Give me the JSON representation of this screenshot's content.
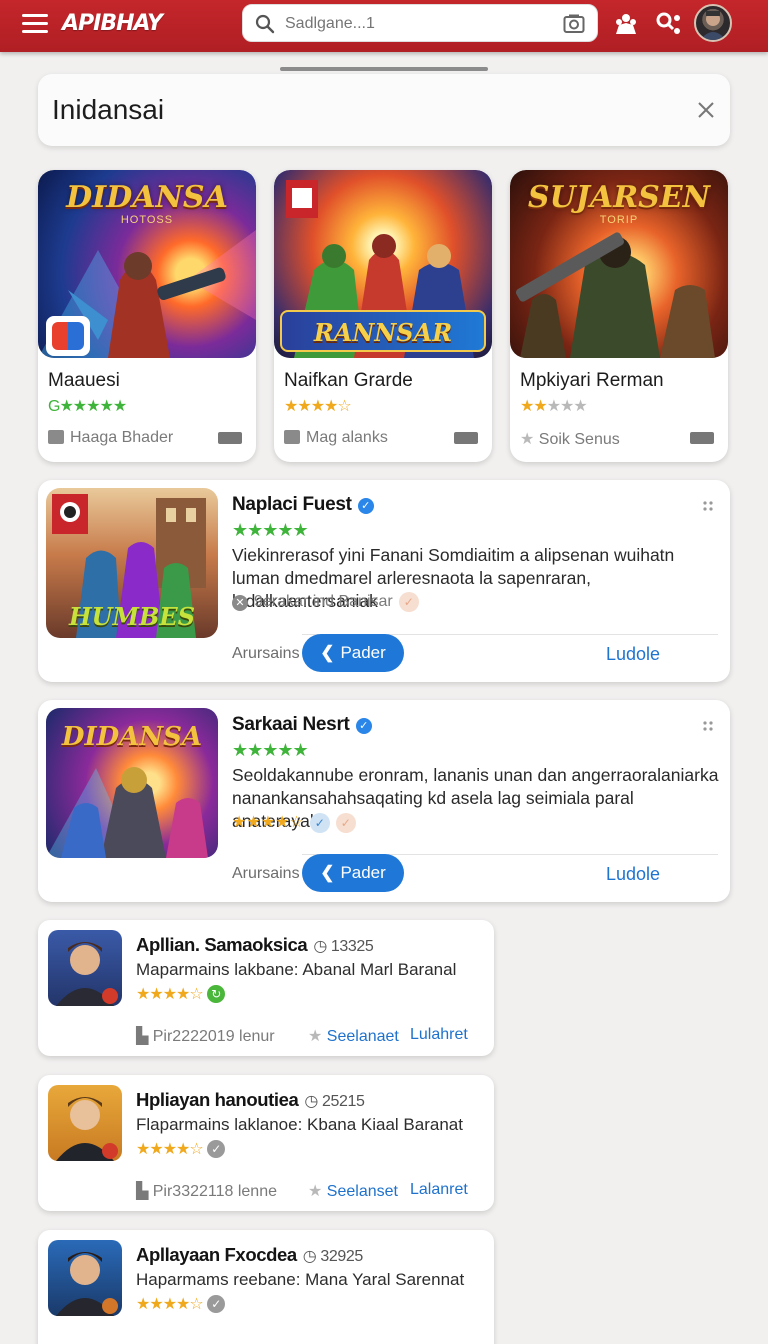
{
  "header": {
    "logo": "APIBHAY",
    "search_placeholder": "Sadlgane...1"
  },
  "panel": {
    "title": "Inidansai"
  },
  "featured": [
    {
      "art_title": "DIDANSA",
      "art_sub": "HOTOSS",
      "name": "Maauesi",
      "rating_text": "G★★★★★",
      "foot": "Haaga Bhader"
    },
    {
      "art_title": "RANNSAR",
      "art_sub": "",
      "name": "Naifkan Grarde",
      "rating_text": "★★★★☆",
      "foot": "Mag alanks"
    },
    {
      "art_title": "SUJARSEN",
      "art_sub": "TORIP",
      "name": "Mpkiyari Rerman",
      "rating_text": "★★★★★",
      "foot": "Soik Senus"
    }
  ],
  "wide": [
    {
      "name": "Naplaci Fuest",
      "stars": "★★★★★",
      "desc": "Viekinrerasof yini Fanani Somdiaitim a alipsenan wuihatn luman dmedmarel arleresnaota la sapenraran, ladalkaantersaniak",
      "meta": "9erakar ind Banisar",
      "left_label": "Arursains",
      "button": "Pader",
      "link": "Ludole",
      "thumb_label": "HUMBES"
    },
    {
      "name": "Sarkaai Nesrt",
      "stars": "★★★★★",
      "desc": "Seoldakannube eronram, lananis unan dan angerraoralaniarka nanankansahahsaqating kd asela lag seimiala paral anaterayaka",
      "meta_stars": "★★★★☆",
      "left_label": "Arursains",
      "button": "Pader",
      "link": "Ludole",
      "thumb_label": "DIDANSA"
    }
  ],
  "list": [
    {
      "name": "Apllian. Samaoksica",
      "count": "13325",
      "desc": "Maparmains lakbane: Abanal Marl Baranal",
      "stars": "★★★★☆",
      "foot": "Pir2222019 lenur",
      "link1": "Seelanaet",
      "link2": "Lulahret"
    },
    {
      "name": "Hpliayan hanoutiea",
      "count": "25215",
      "desc": "Flaparmains laklanoe: Kbana Kiaal Baranat",
      "stars": "★★★★☆",
      "foot": "Pir3322118 lenne",
      "link1": "Seelanset",
      "link2": "Lalanret"
    },
    {
      "name": "Apllayaan Fxocdea",
      "count": "32925",
      "desc": "Haparmams reebane: Mana Yaral Sarennat",
      "stars": "★★★★☆",
      "foot": "",
      "link1": "",
      "link2": ""
    }
  ],
  "colors": {
    "brand_red": "#b8222a",
    "accent_blue": "#1f78d8",
    "star_gold": "#f0a81c",
    "rating_green": "#3fb43a"
  }
}
